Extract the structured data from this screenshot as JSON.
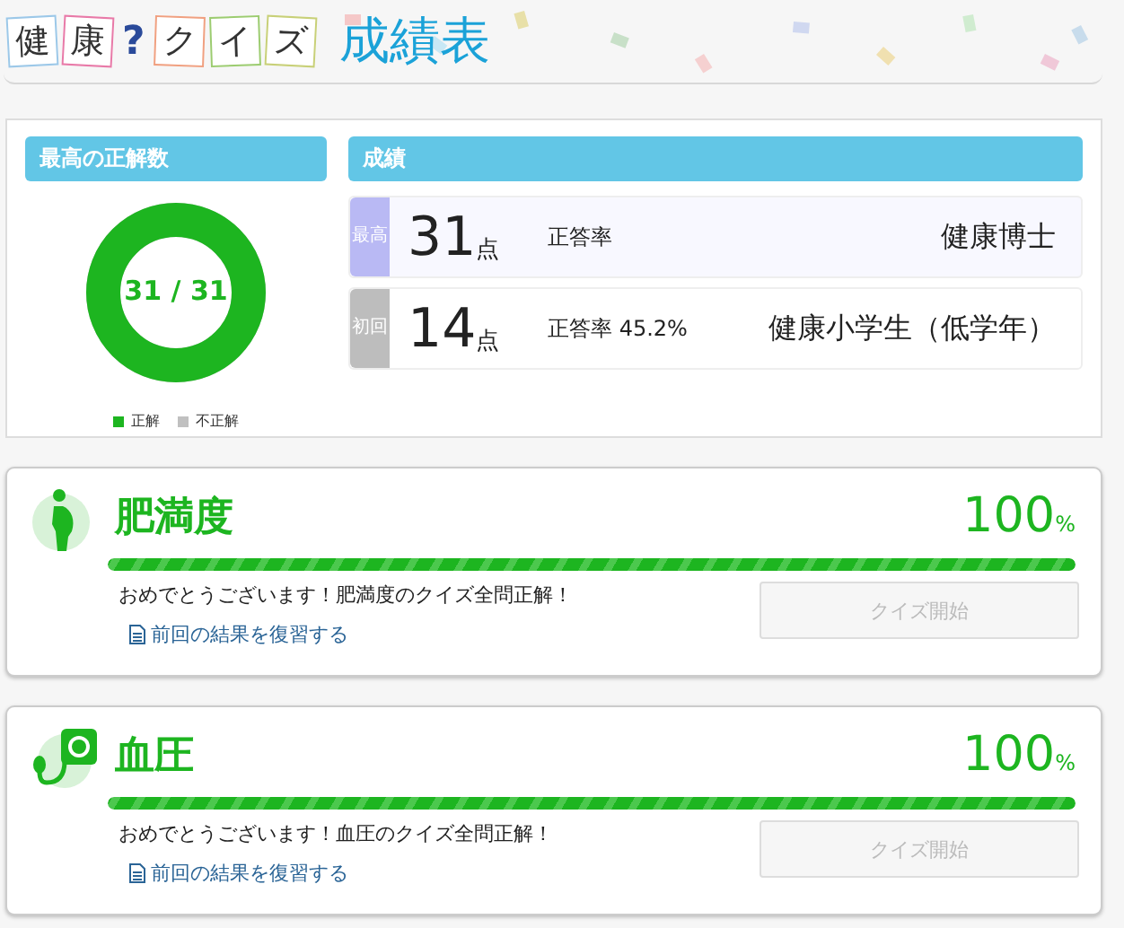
{
  "header": {
    "tiles": [
      {
        "kind": "tile",
        "char": "健",
        "color": "#9cc8e8"
      },
      {
        "kind": "tile",
        "char": "康",
        "color": "#e87aa8"
      },
      {
        "kind": "mark",
        "char": "?",
        "color": "#2a4a9a"
      },
      {
        "kind": "tile",
        "char": "ク",
        "color": "#f0a080"
      },
      {
        "kind": "tile",
        "char": "イ",
        "color": "#9ccc70"
      },
      {
        "kind": "tile",
        "char": "ズ",
        "color": "#c8d078"
      }
    ],
    "title": "成績表"
  },
  "summary": {
    "best_heading": "最高の正解数",
    "donut": {
      "level": 1,
      "label": "31 / 31"
    },
    "legend": [
      {
        "label": "正解",
        "color": "#1db520"
      },
      {
        "label": "不正解",
        "color": "#c0c0c0"
      }
    ],
    "results_heading": "成績",
    "results": [
      {
        "tag": "最高",
        "color": "#b9b9f4",
        "score": "31",
        "unit": "点",
        "rate": "正答率",
        "rank": "健康博士"
      },
      {
        "tag": "初回",
        "color": "#bdbdbd",
        "score": "14",
        "unit": "点",
        "rate": "正答率 45.2%",
        "rank": "健康小学生（低学年）"
      }
    ]
  },
  "categories": [
    {
      "kind": "body",
      "title": "肥満度",
      "percent": "100",
      "percent_unit": "%",
      "level": 1,
      "message": "おめでとうございます！肥満度のクイズ全問正解！",
      "review_link": "前回の結果を復習する",
      "button": "クイズ開始",
      "disabled": true
    },
    {
      "kind": "pressure",
      "title": "血圧",
      "percent": "100",
      "percent_unit": "%",
      "level": 1,
      "message": "おめでとうございます！血圧のクイズ全問正解！",
      "review_link": "前回の結果を復習する",
      "button": "クイズ開始",
      "disabled": true
    }
  ]
}
